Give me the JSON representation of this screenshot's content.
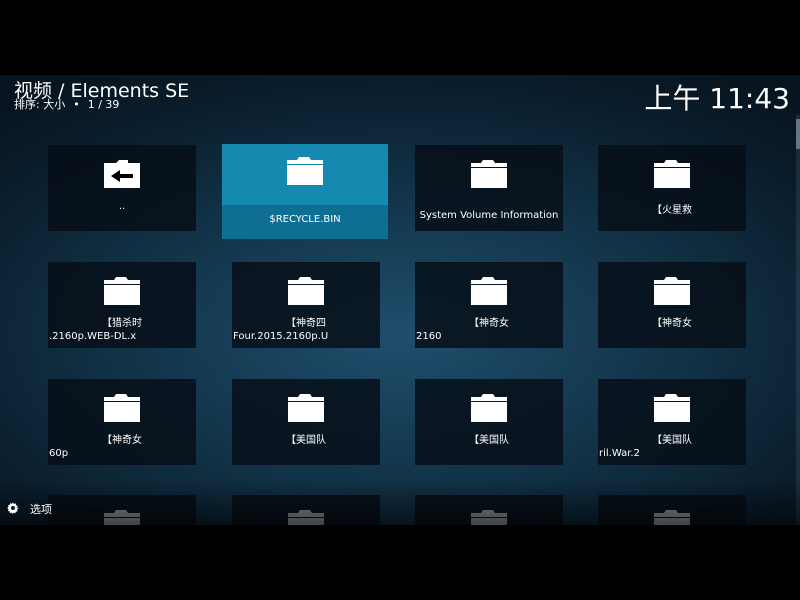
{
  "header": {
    "title": "视频 / Elements SE",
    "sort_label": "排序: 大小",
    "position": "1 / 39",
    "clock": "上午 11:43"
  },
  "footer": {
    "options_label": "选项",
    "options_icon": "gear-icon"
  },
  "colors": {
    "accent": "#1589b0",
    "tile_bg": "#070f18",
    "background": "#0c2535"
  },
  "items": [
    {
      "label": "..",
      "sub": "",
      "icon": "folder-back-icon"
    },
    {
      "label": "$RECYCLE.BIN",
      "sub": "",
      "icon": "folder-icon"
    },
    {
      "label": "System Volume Information",
      "sub": "",
      "icon": "folder-icon"
    },
    {
      "label": "【火星救",
      "sub": "",
      "icon": "folder-icon"
    },
    {
      "label": "【猎杀时",
      "sub": ".2160p.WEB-DL.x",
      "icon": "folder-icon"
    },
    {
      "label": "【神奇四",
      "sub": "Four.2015.2160p.U",
      "icon": "folder-icon"
    },
    {
      "label": "【神奇女",
      "sub": "2160",
      "icon": "folder-icon"
    },
    {
      "label": "【神奇女",
      "sub": "",
      "icon": "folder-icon"
    },
    {
      "label": "【神奇女",
      "sub": "60p",
      "icon": "folder-icon"
    },
    {
      "label": "【美国队",
      "sub": "",
      "icon": "folder-icon"
    },
    {
      "label": "【美国队",
      "sub": "",
      "icon": "folder-icon"
    },
    {
      "label": "【美国队",
      "sub": "ril.War.2",
      "icon": "folder-icon"
    },
    {
      "label": "",
      "sub": "",
      "icon": "folder-icon"
    },
    {
      "label": "",
      "sub": "",
      "icon": "folder-icon"
    },
    {
      "label": "",
      "sub": "",
      "icon": "folder-icon"
    },
    {
      "label": "",
      "sub": "",
      "icon": "folder-icon"
    }
  ]
}
